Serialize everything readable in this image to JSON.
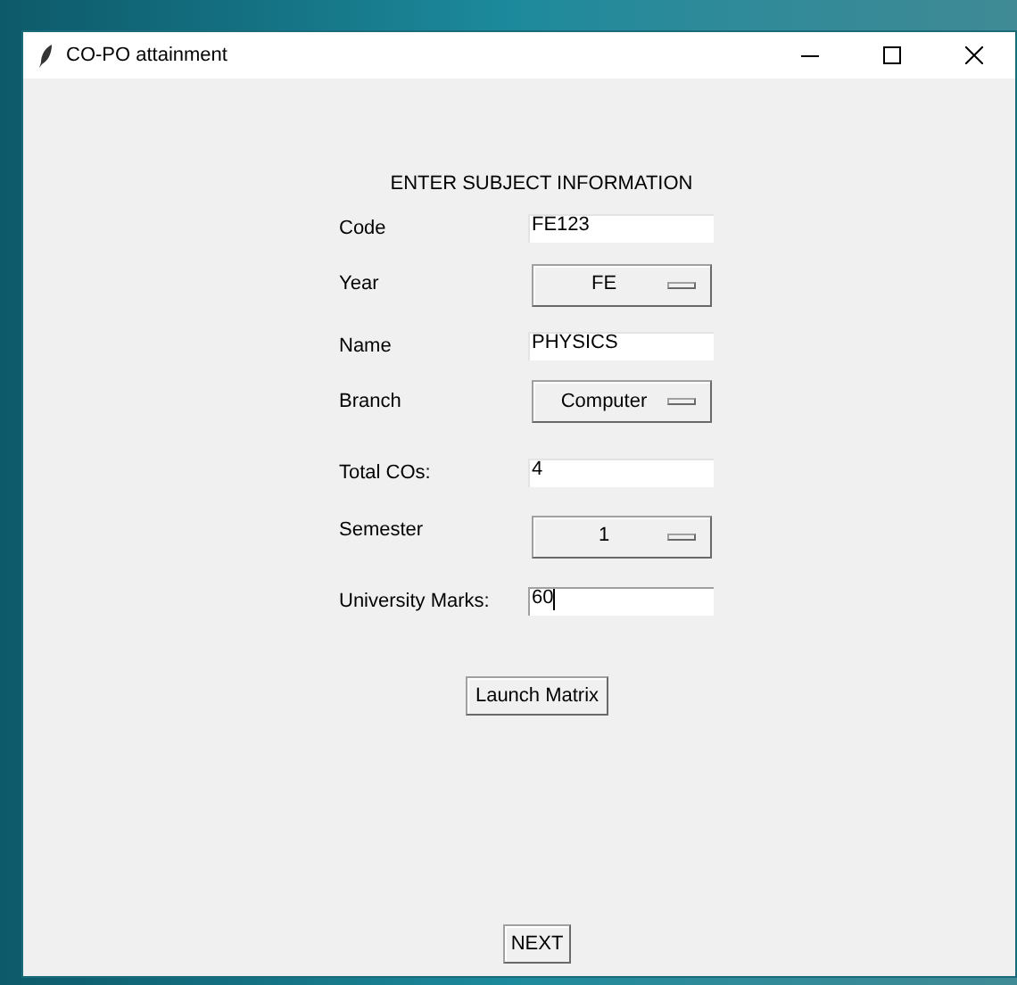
{
  "window": {
    "title": "CO-PO attainment"
  },
  "heading": "ENTER SUBJECT INFORMATION",
  "fields": [
    {
      "kind": "entry",
      "label": "Code",
      "value": "FE123",
      "focused": false
    },
    {
      "kind": "option",
      "label": "Year",
      "value": "FE"
    },
    {
      "kind": "entry",
      "label": "Name",
      "value": "PHYSICS",
      "focused": false
    },
    {
      "kind": "option",
      "label": "Branch",
      "value": "Computer"
    },
    {
      "kind": "entry",
      "label": "Total COs:",
      "value": "4",
      "focused": false
    },
    {
      "kind": "option",
      "label": "Semester",
      "value": "1"
    },
    {
      "kind": "entry",
      "label": "University Marks:",
      "value": "60",
      "focused": true
    }
  ],
  "launch_button": "Launch Matrix",
  "next_button": "NEXT"
}
